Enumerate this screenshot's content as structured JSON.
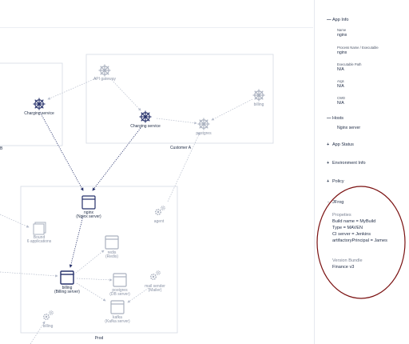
{
  "graph": {
    "nodes": {
      "api_gateway": "API gateway",
      "charging_left": "Charging service",
      "charging_center": "Charging service",
      "postgres_top": "postgres",
      "billing_top": "billing",
      "customer_a": "Customer A",
      "left_cluster_tail": "B",
      "nginx": "nginx",
      "nginx_sub": "(Nginx server)",
      "bound": "Bound",
      "bound_sub": "6 applications",
      "agent": "agent",
      "redis": "redis",
      "redis_sub": "(Redis)",
      "billing_main": "billing",
      "billing_main_sub": "(Billing server)",
      "postgres_db": "postgres",
      "postgres_db_sub": "(DB server)",
      "mail_sender": "mail sender",
      "mail_sender_sub": "(Mailer)",
      "kafka": "kafka",
      "kafka_sub": "(Kafka server)",
      "billing_bottom": "billing",
      "prod": "Prod"
    }
  },
  "panel": {
    "app_info": {
      "title": "App Info",
      "name_label": "Name",
      "name_value": "nginx",
      "process_label": "Process Name / Executable",
      "process_value": "nginx",
      "exec_label": "Executable Path",
      "exec_value": "N/A",
      "args_label": "Args",
      "args_value": "N/A",
      "cwd_label": "CWD",
      "cwd_value": "N/A"
    },
    "hosts": {
      "title": "Hosts",
      "value": "Nginx server"
    },
    "app_status": "App Status",
    "env_info": "Environment Info",
    "policy": "Policy",
    "jfrog": {
      "title": "JFrog",
      "properties_label": "Propeties",
      "properties": [
        "Build name = MyBuild",
        "Type = MAVEN",
        "CI server = Jenkins",
        "artifactoryPrincipal = James"
      ],
      "bundle_label": "Version Bundle",
      "bundle_value": "Finance v3"
    }
  },
  "colors": {
    "accent": "#1d2a44",
    "ellipse": "#7a1010",
    "muted_icon": "#aab1bf",
    "dark_icon": "#25306a"
  }
}
